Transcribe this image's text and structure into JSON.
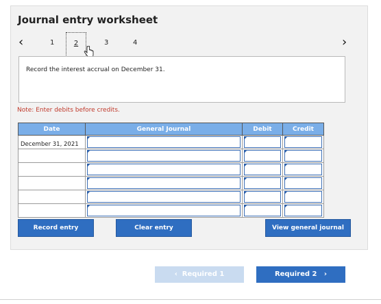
{
  "worksheet": {
    "title": "Journal entry worksheet",
    "steps": [
      "1",
      "2",
      "3",
      "4"
    ],
    "instruction": "Record the interest accrual on December 31.",
    "note": "Note: Enter debits before credits."
  },
  "table": {
    "headers": [
      "Date",
      "General Journal",
      "Debit",
      "Credit"
    ],
    "rows": [
      {
        "date": "December 31, 2021"
      },
      {
        "date": ""
      },
      {
        "date": ""
      },
      {
        "date": ""
      },
      {
        "date": ""
      },
      {
        "date": ""
      }
    ]
  },
  "buttons": {
    "record": "Record entry",
    "clear": "Clear entry",
    "view": "View general journal"
  },
  "footer": {
    "prev": "Required 1",
    "next": "Required 2"
  },
  "colors": {
    "header_bg": "#7aaee8",
    "button_bg": "#2f6ec1",
    "note_text": "#c0392b",
    "disabled_button_bg": "#c9dbf0"
  }
}
